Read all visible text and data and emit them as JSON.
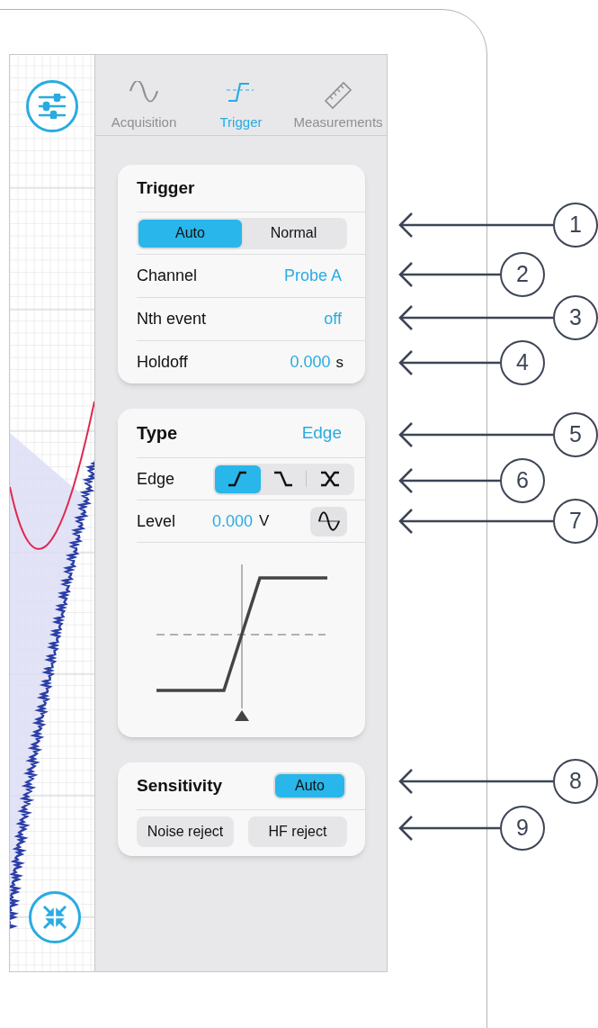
{
  "tabs": [
    {
      "label": "Acquisition",
      "kind": "sine",
      "selected": false
    },
    {
      "label": "Trigger",
      "kind": "trigger",
      "selected": true
    },
    {
      "label": "Measurements",
      "kind": "ruler",
      "selected": false
    }
  ],
  "trigger_card": {
    "title": "Trigger",
    "mode": [
      {
        "label": "Auto",
        "selected": true
      },
      {
        "label": "Normal",
        "selected": false
      }
    ],
    "rows": [
      {
        "label": "Channel",
        "value": "Probe A"
      },
      {
        "label": "Nth event",
        "value": "off"
      },
      {
        "label": "Holdoff",
        "value": "0.000",
        "unit": "s"
      }
    ]
  },
  "type_card": {
    "title": "Type",
    "value": "Edge",
    "edge_label": "Edge",
    "edges": [
      {
        "kind": "rising",
        "selected": true
      },
      {
        "kind": "falling",
        "selected": false
      },
      {
        "kind": "either",
        "selected": false
      }
    ],
    "level_label": "Level",
    "level_value": "0.000",
    "level_unit": "V"
  },
  "sensitivity_card": {
    "title": "Sensitivity",
    "auto": {
      "label": "Auto",
      "selected": true
    },
    "filters": [
      {
        "label": "Noise reject",
        "selected": false
      },
      {
        "label": "HF reject",
        "selected": false
      }
    ]
  },
  "callouts": [
    "1",
    "2",
    "3",
    "4",
    "5",
    "6",
    "7",
    "8",
    "9"
  ]
}
